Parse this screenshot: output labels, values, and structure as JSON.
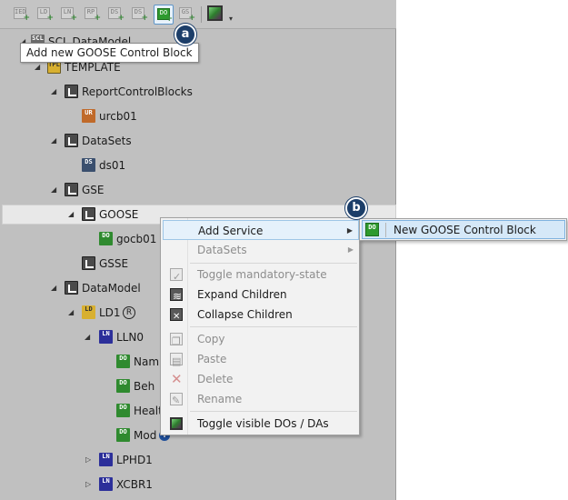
{
  "toolbar": {
    "buttons": [
      {
        "glyph": "IED",
        "icon": "add-ied-icon"
      },
      {
        "glyph": "LD",
        "icon": "add-ld-icon"
      },
      {
        "glyph": "LN",
        "icon": "add-ln-icon"
      },
      {
        "glyph": "RP",
        "icon": "add-rp-icon"
      },
      {
        "glyph": "DS",
        "icon": "add-ds-icon"
      },
      {
        "glyph": "DS",
        "icon": "add-ds2-icon"
      },
      {
        "glyph": "DO",
        "icon": "add-goose-control-block-icon",
        "active": true
      },
      {
        "glyph": "GS",
        "icon": "add-gs-icon"
      }
    ],
    "more_glyph": "▾"
  },
  "tooltip": {
    "text": "Add new GOOSE Control Block"
  },
  "callouts": {
    "a": "a",
    "b": "b"
  },
  "tree": {
    "root": {
      "label": "SCL DataModel",
      "glyph": "SCL"
    },
    "template": {
      "label": "TEMPLATE",
      "glyph": "TPL"
    },
    "report_blocks": {
      "label": "ReportControlBlocks"
    },
    "urcb": {
      "label": "urcb01",
      "glyph": "UR"
    },
    "datasets": {
      "label": "DataSets"
    },
    "ds01": {
      "label": "ds01",
      "glyph": "DS"
    },
    "gse": {
      "label": "GSE"
    },
    "goose": {
      "label": "GOOSE"
    },
    "gocb": {
      "label": "gocb01",
      "glyph": "DO"
    },
    "gsse": {
      "label": "GSSE"
    },
    "datamodel": {
      "label": "DataModel"
    },
    "ld1": {
      "label": "LD1",
      "glyph": "LD",
      "badge": "R"
    },
    "lln0": {
      "label": "LLN0",
      "glyph": "LN"
    },
    "nampl": {
      "label": "NamP",
      "glyph": "DO"
    },
    "beh": {
      "label": "Beh",
      "glyph": "DO"
    },
    "health": {
      "label": "Health",
      "glyph": "DO"
    },
    "mod": {
      "label": "Mod",
      "glyph": "DO",
      "badge": "i"
    },
    "lphd1": {
      "label": "LPHD1",
      "glyph": "LN"
    },
    "xcbr1": {
      "label": "XCBR1",
      "glyph": "LN"
    }
  },
  "context_menu": {
    "add_service": "Add Service",
    "datasets": "DataSets",
    "toggle_mandatory": "Toggle mandatory-state",
    "expand_children": "Expand Children",
    "collapse_children": "Collapse Children",
    "copy": "Copy",
    "paste": "Paste",
    "delete": "Delete",
    "rename": "Rename",
    "toggle_visible": "Toggle visible DOs / DAs"
  },
  "submenu": {
    "new_goose": "New GOOSE Control Block",
    "glyph": "DO"
  }
}
